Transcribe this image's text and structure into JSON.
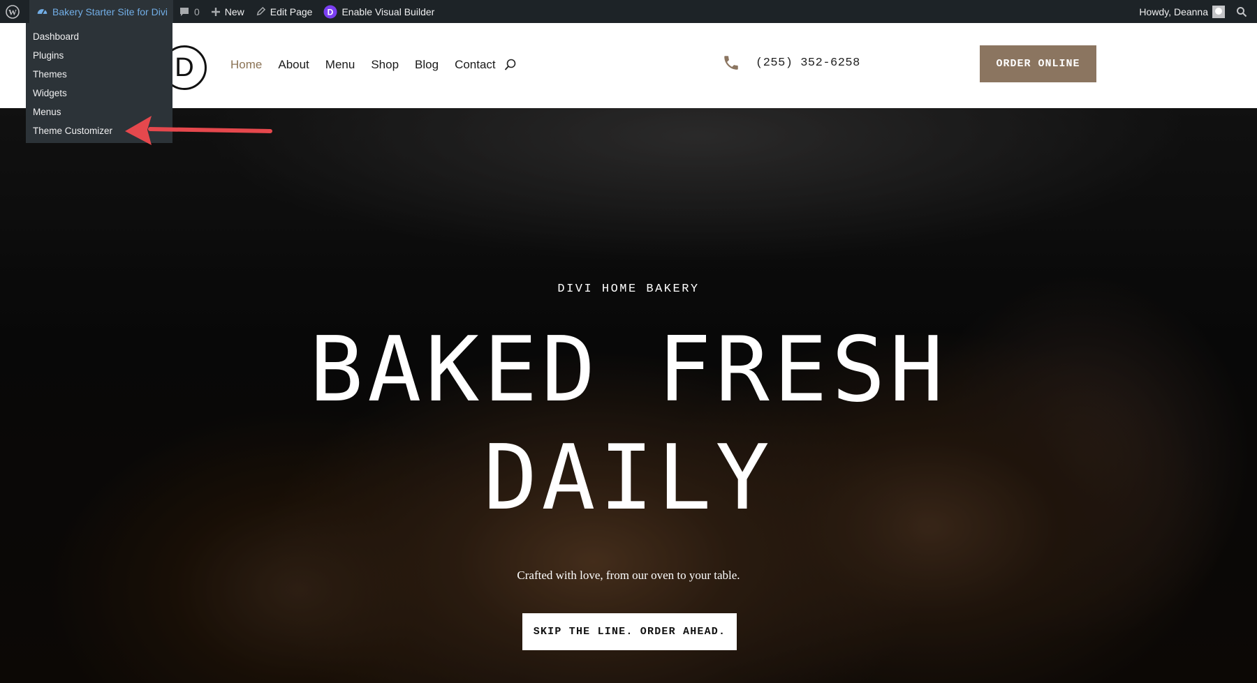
{
  "admin_bar": {
    "site_name": "Bakery Starter Site for Divi",
    "comments_count": "0",
    "new_label": "New",
    "edit_page_label": "Edit Page",
    "visual_builder_label": "Enable Visual Builder",
    "greeting": "Howdy, Deanna",
    "dropdown": [
      "Dashboard",
      "Plugins",
      "Themes",
      "Widgets",
      "Menus",
      "Theme Customizer"
    ]
  },
  "header": {
    "logo_letter": "D",
    "nav": [
      "Home",
      "About",
      "Menu",
      "Shop",
      "Blog",
      "Contact"
    ],
    "active_nav": "Home",
    "phone": "(255) 352-6258",
    "order_button": "ORDER ONLINE"
  },
  "hero": {
    "eyebrow": "DIVI HOME BAKERY",
    "headline_line1": "BAKED FRESH",
    "headline_line2": "DAILY",
    "subtitle": "Crafted with love, from our oven to your table.",
    "cta": "SKIP THE LINE. ORDER AHEAD."
  },
  "colors": {
    "admin_bg": "#1d2327",
    "admin_link": "#72aee6",
    "accent_brown": "#8b7560",
    "annotation_arrow": "#e5484d"
  }
}
